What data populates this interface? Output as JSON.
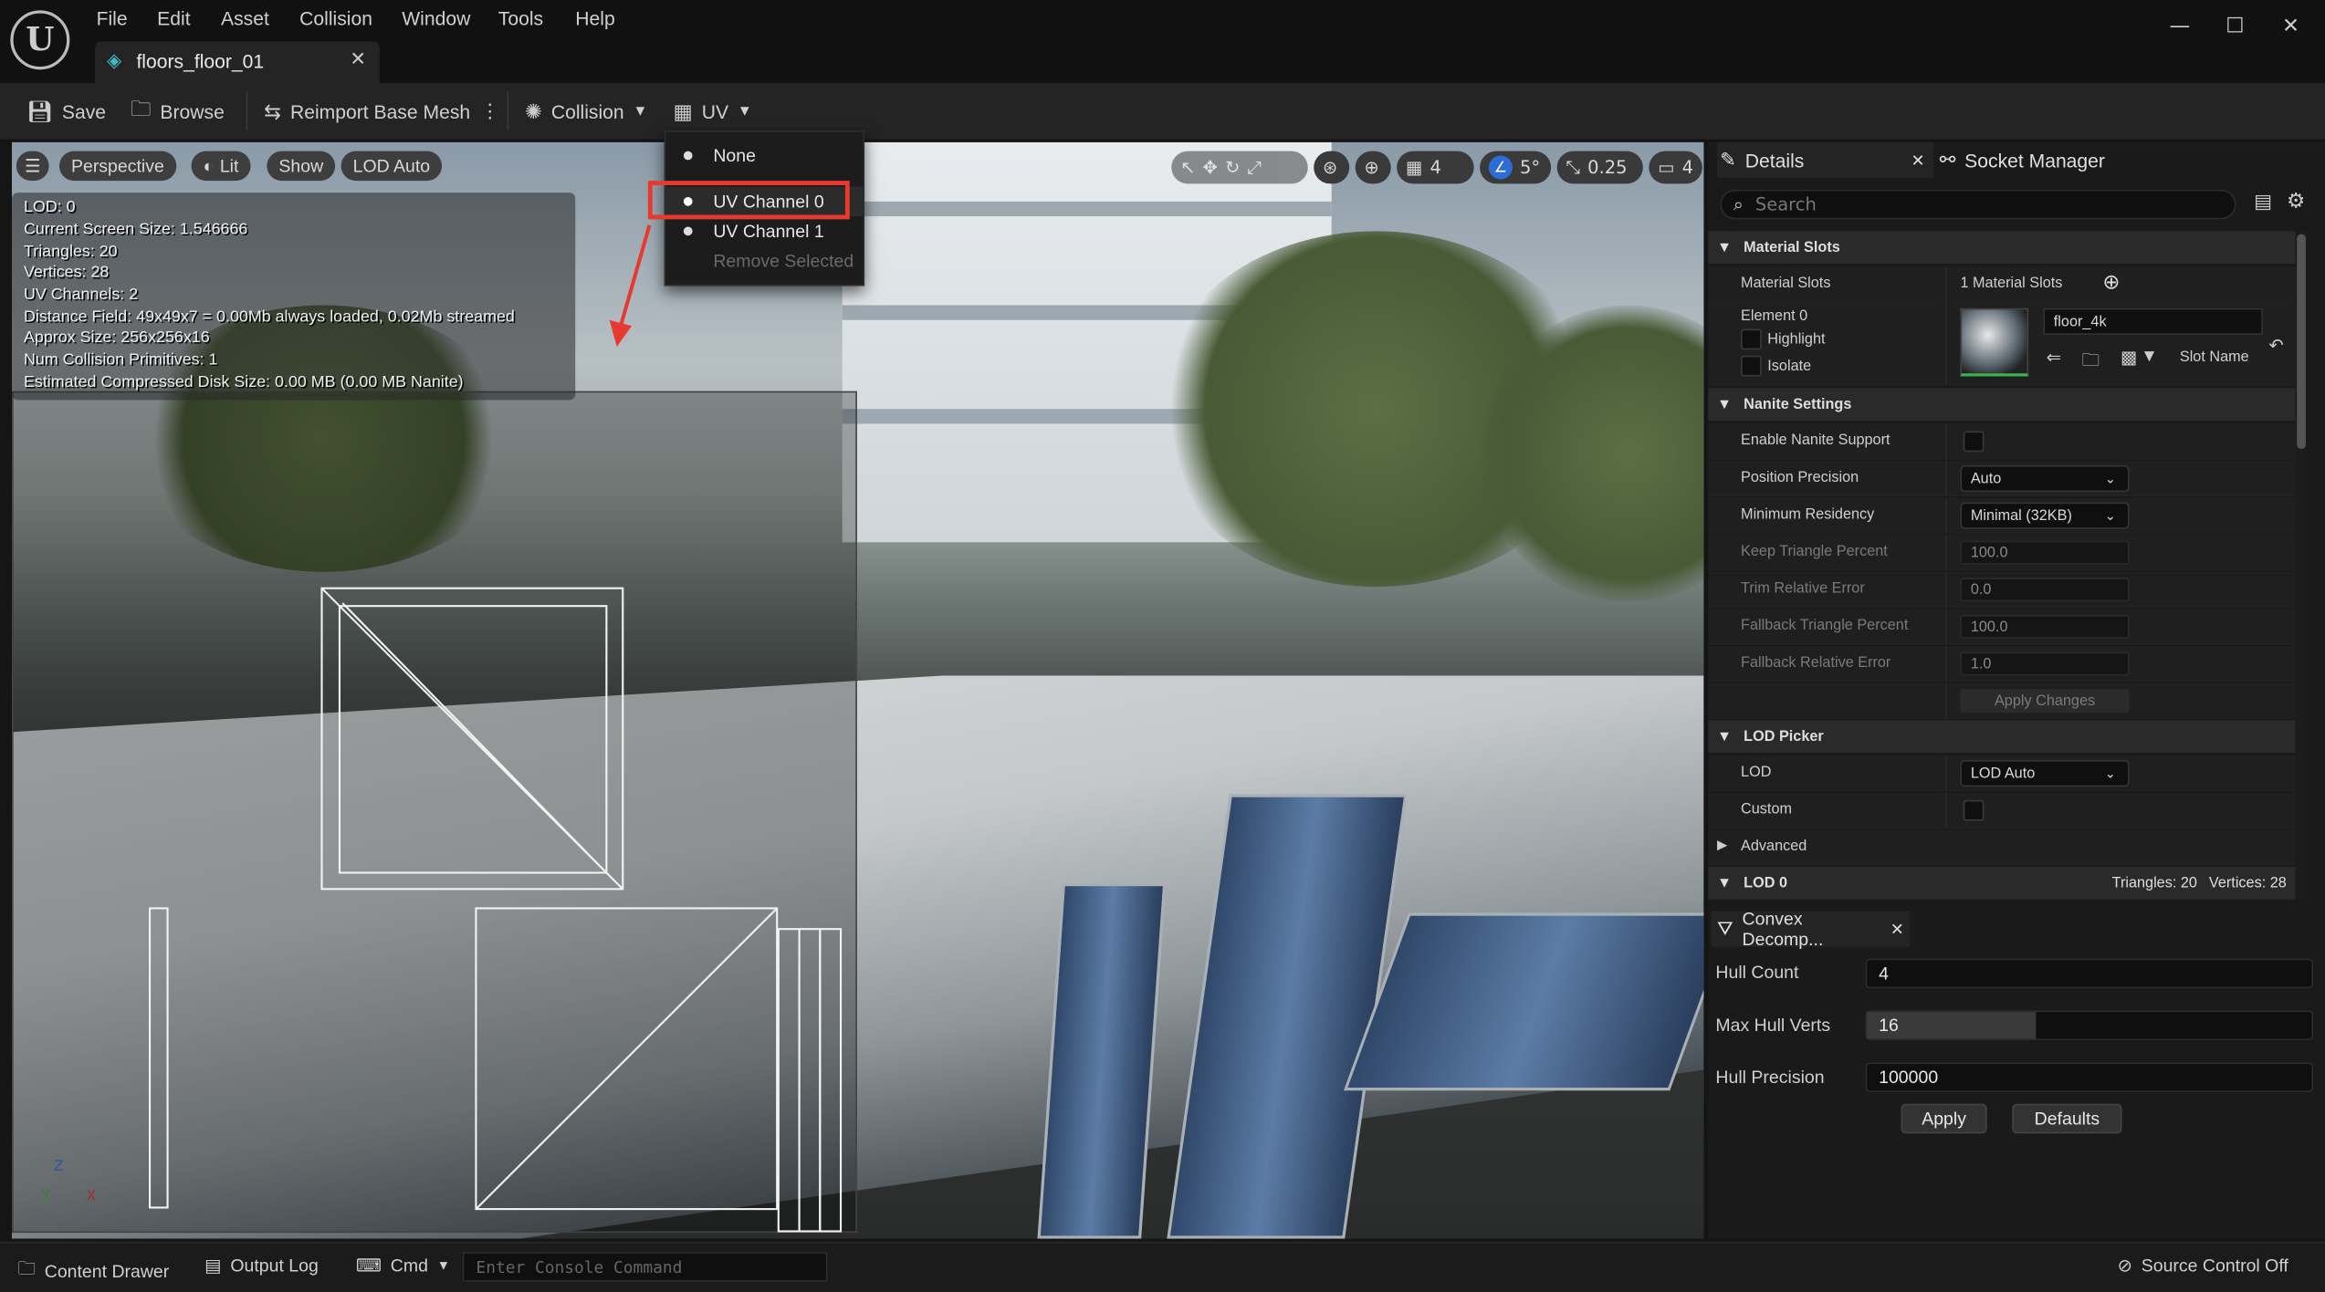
{
  "app": {
    "menu": [
      "File",
      "Edit",
      "Asset",
      "Collision",
      "Window",
      "Tools",
      "Help"
    ],
    "tab_title": "floors_floor_01"
  },
  "toolbar": {
    "save": "Save",
    "browse": "Browse",
    "reimport": "Reimport Base Mesh",
    "collision": "Collision",
    "uv": "UV"
  },
  "uv_menu": {
    "items": [
      "None",
      "UV Channel 0",
      "UV Channel 1",
      "Remove Selected"
    ],
    "selected": "UV Channel 0",
    "highlight_color": "#e8392e"
  },
  "viewport": {
    "perspective": "Perspective",
    "lit": "Lit",
    "show": "Show",
    "lod": "LOD Auto",
    "grid_value": "4",
    "angle_value": "5°",
    "scale_value": "0.25",
    "camera_speed": "4",
    "stats": [
      "LOD:  0",
      "Current Screen Size:  1.546666",
      "Triangles:  20",
      "Vertices:  28",
      "UV Channels:  2",
      "Distance Field:  49x49x7 = 0.00Mb always loaded, 0.02Mb streamed",
      "Approx Size: 256x256x16",
      "Num Collision Primitives:  1",
      "Estimated Compressed Disk Size: 0.00 MB (0.00 MB Nanite)"
    ],
    "axis": {
      "z": "Z",
      "y": "Y",
      "x": "X"
    }
  },
  "details": {
    "tab": "Details",
    "socket_tab": "Socket Manager",
    "search_placeholder": "Search",
    "material_slots": {
      "header": "Material Slots",
      "label": "Material Slots",
      "count": "1 Material Slots",
      "element": "Element 0",
      "highlight": "Highlight",
      "isolate": "Isolate",
      "material_name": "floor_4k",
      "slot_name": "Slot Name"
    },
    "nanite": {
      "header": "Nanite Settings",
      "enable": "Enable Nanite Support",
      "position_precision": "Position Precision",
      "position_precision_value": "Auto",
      "min_residency": "Minimum Residency",
      "min_residency_value": "Minimal (32KB)",
      "keep_triangle": "Keep Triangle Percent",
      "keep_triangle_value": "100.0",
      "trim_error": "Trim Relative Error",
      "trim_error_value": "0.0",
      "fallback_triangle": "Fallback Triangle Percent",
      "fallback_triangle_value": "100.0",
      "fallback_error": "Fallback Relative Error",
      "fallback_error_value": "1.0",
      "apply": "Apply Changes"
    },
    "lod_picker": {
      "header": "LOD Picker",
      "lod": "LOD",
      "lod_value": "LOD Auto",
      "custom": "Custom",
      "advanced": "Advanced"
    },
    "lod0": {
      "header": "LOD 0",
      "triangles": "Triangles: 20",
      "vertices": "Vertices: 28"
    }
  },
  "convex": {
    "tab": "Convex Decomp...",
    "hull_count_label": "Hull Count",
    "hull_count": "4",
    "max_hull_verts_label": "Max Hull Verts",
    "max_hull_verts": "16",
    "max_hull_verts_fraction": 0.38,
    "hull_precision_label": "Hull Precision",
    "hull_precision": "100000",
    "apply": "Apply",
    "defaults": "Defaults"
  },
  "statusbar": {
    "content_drawer": "Content Drawer",
    "output_log": "Output Log",
    "cmd": "Cmd",
    "console_placeholder": "Enter Console Command",
    "source_control": "Source Control Off"
  }
}
